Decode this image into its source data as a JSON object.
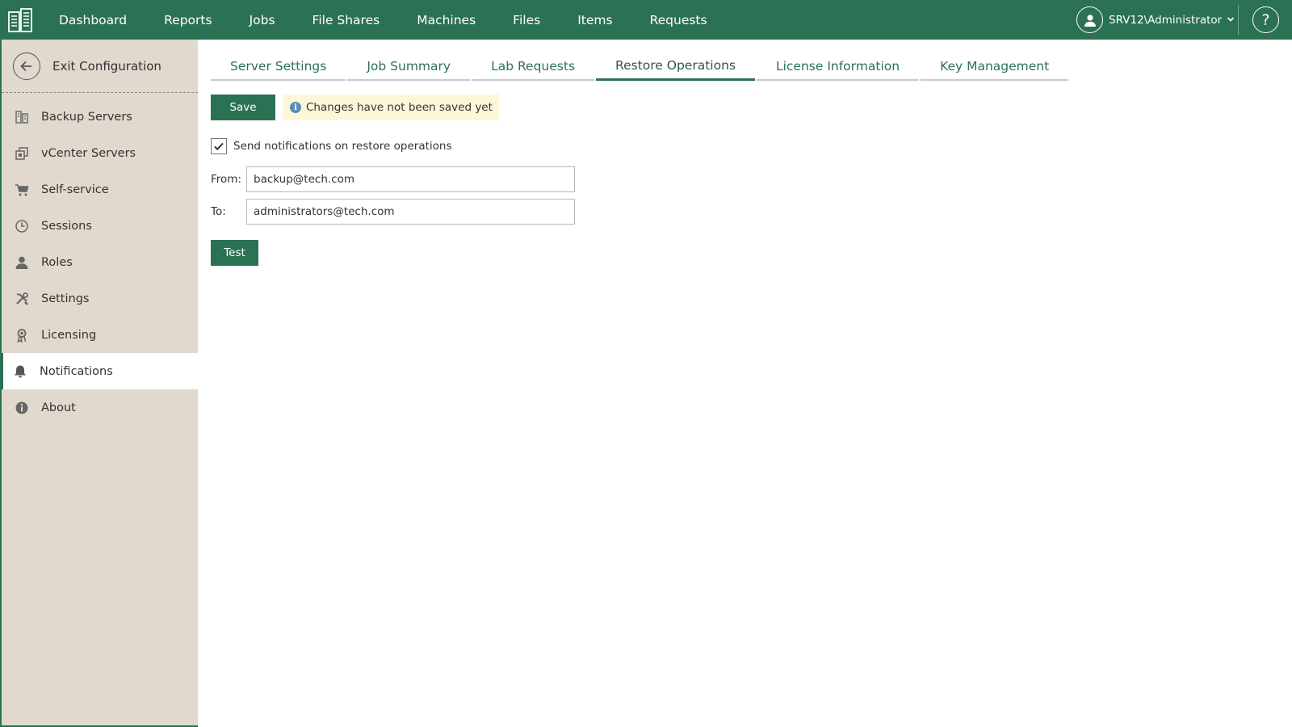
{
  "topnav": {
    "items": [
      "Dashboard",
      "Reports",
      "Jobs",
      "File Shares",
      "Machines",
      "Files",
      "Items",
      "Requests"
    ],
    "user": "SRV12\\Administrator",
    "help_glyph": "?"
  },
  "sidebar": {
    "exit_label": "Exit Configuration",
    "items": [
      {
        "label": "Backup Servers",
        "icon": "backup-servers-icon"
      },
      {
        "label": "vCenter Servers",
        "icon": "vcenter-icon"
      },
      {
        "label": "Self-service",
        "icon": "cart-icon"
      },
      {
        "label": "Sessions",
        "icon": "clock-icon"
      },
      {
        "label": "Roles",
        "icon": "person-icon"
      },
      {
        "label": "Settings",
        "icon": "tools-icon"
      },
      {
        "label": "Licensing",
        "icon": "license-icon"
      },
      {
        "label": "Notifications",
        "icon": "bell-icon",
        "active": true
      },
      {
        "label": "About",
        "icon": "info-icon"
      }
    ]
  },
  "tabs": [
    {
      "label": "Server Settings"
    },
    {
      "label": "Job Summary"
    },
    {
      "label": "Lab Requests"
    },
    {
      "label": "Restore Operations",
      "active": true
    },
    {
      "label": "License Information"
    },
    {
      "label": "Key Management"
    }
  ],
  "form": {
    "save_label": "Save",
    "unsaved_message": "Changes have not been saved yet",
    "checkbox_label": "Send notifications on restore operations",
    "checkbox_checked": true,
    "from_label": "From:",
    "from_value": "backup@tech.com",
    "to_label": "To:",
    "to_value": "administrators@tech.com",
    "test_label": "Test"
  },
  "colors": {
    "brand": "#2b7153",
    "sidebar_bg": "#e1d9ce",
    "notice_bg": "#fdf6d8"
  }
}
